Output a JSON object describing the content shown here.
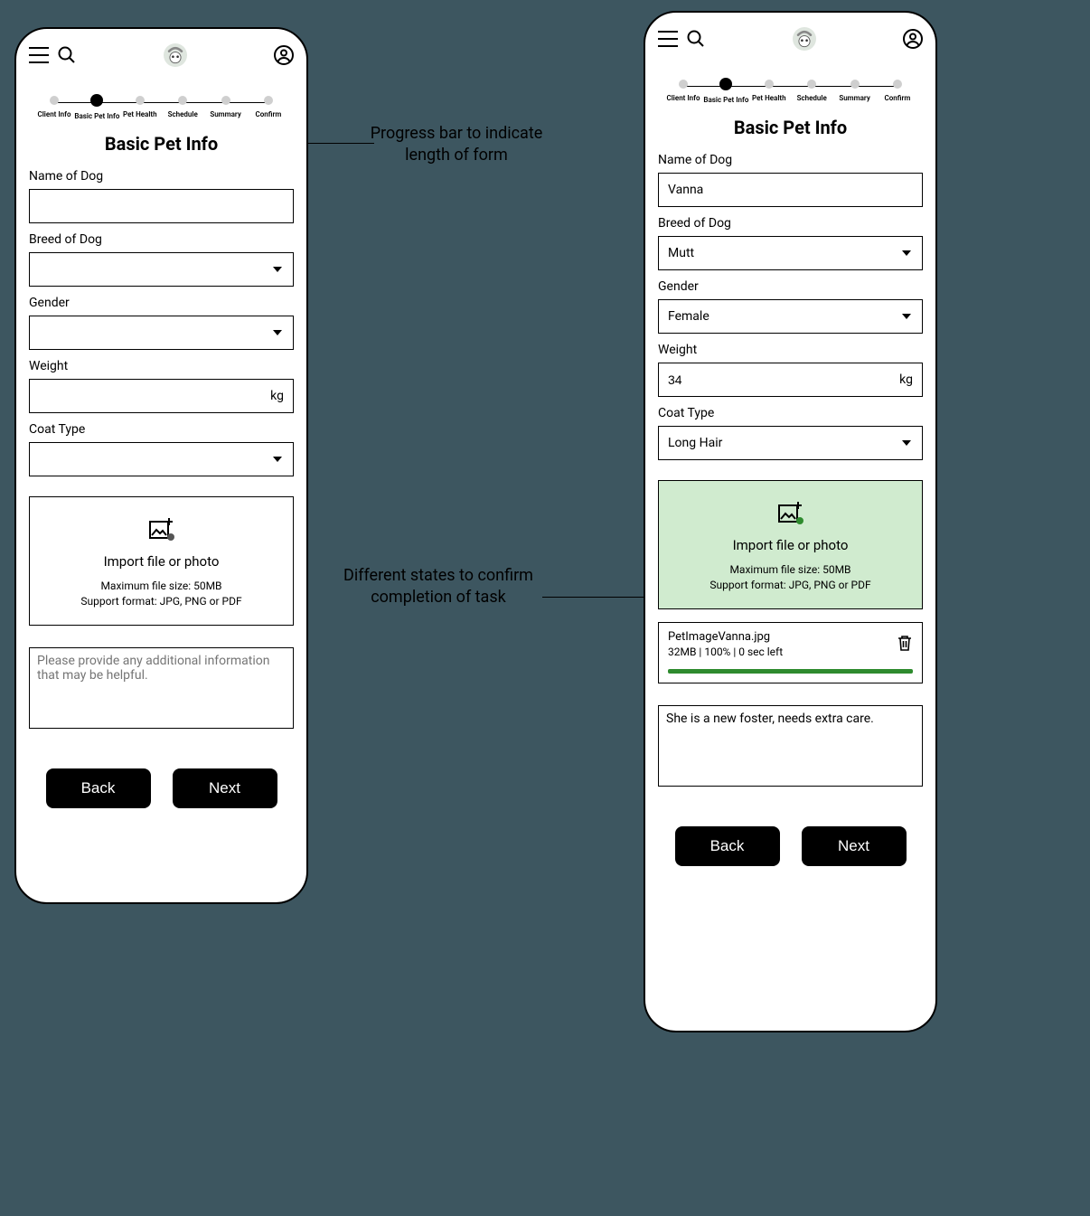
{
  "annotations": {
    "progress": "Progress bar to indicate length of form",
    "states": "Different states to confirm completion of task"
  },
  "stepper": {
    "steps": [
      "Client Info",
      "Basic Pet Info",
      "Pet Health",
      "Schedule",
      "Summary",
      "Confirm"
    ],
    "active_index": 1
  },
  "page_title": "Basic Pet Info",
  "labels": {
    "name": "Name of Dog",
    "breed": "Breed of Dog",
    "gender": "Gender",
    "weight": "Weight",
    "weight_unit": "kg",
    "coat": "Coat Type"
  },
  "upload": {
    "title": "Import file or photo",
    "line1": "Maximum file size: 50MB",
    "line2": "Support format: JPG, PNG or PDF"
  },
  "textarea_placeholder": "Please provide any additional information that may be helpful.",
  "buttons": {
    "back": "Back",
    "next": "Next"
  },
  "left": {
    "name": "",
    "breed": "",
    "gender": "",
    "weight": "",
    "coat": "",
    "notes": ""
  },
  "right": {
    "name": "Vanna",
    "breed": "Mutt",
    "gender": "Female",
    "weight": "34",
    "coat": "Long Hair",
    "file": {
      "name": "PetImageVanna.jpg",
      "meta": "32MB | 100% | 0 sec left"
    },
    "notes": "She is a new foster, needs extra care."
  }
}
